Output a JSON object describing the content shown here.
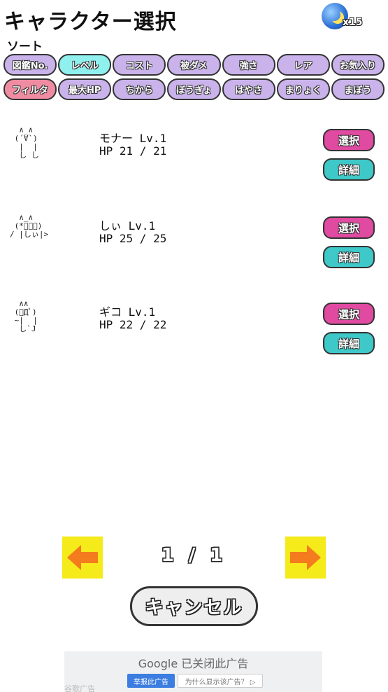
{
  "header": {
    "title": "キャラクター選択",
    "coin_icon": "moon-coin-icon",
    "coin_count": "x15"
  },
  "sort": {
    "label": "ソート",
    "chips": [
      {
        "label": "図鑑No.",
        "active": false
      },
      {
        "label": "レベル",
        "active": true
      },
      {
        "label": "コスト",
        "active": false
      },
      {
        "label": "被ダメ",
        "active": false
      },
      {
        "label": "強さ",
        "active": false
      },
      {
        "label": "レア",
        "active": false
      },
      {
        "label": "お気入り",
        "active": false
      }
    ],
    "filter_chips": [
      {
        "label": "フィルタ",
        "filter": true
      },
      {
        "label": "最大HP"
      },
      {
        "label": "ちから"
      },
      {
        "label": "ぼうぎょ"
      },
      {
        "label": "はやさ"
      },
      {
        "label": "まりょく"
      },
      {
        "label": "まぼう"
      }
    ]
  },
  "characters": [
    {
      "ascii": "  ∧_∧\n (´∀`)\n  |  |\n  し し",
      "name_level": "モナー Lv.1",
      "hp": "HP 21 / 21",
      "select_label": "選択",
      "detail_label": "詳細"
    },
    {
      "ascii": "  ∧_∧\n (*ﾟーﾟ)\n/ |しぃ|>",
      "name_level": "しぃ Lv.1",
      "hp": "HP 25 / 25",
      "select_label": "選択",
      "detail_label": "詳細"
    },
    {
      "ascii": "  ∧∧\n (ﾟДﾟ)\n ~|  |\n  し`J",
      "name_level": "ギコ Lv.1",
      "hp": "HP 22 / 22",
      "select_label": "選択",
      "detail_label": "詳細"
    }
  ],
  "pagination": {
    "indicator": "1 / 1",
    "prev_icon": "arrow-left-icon",
    "next_icon": "arrow-right-icon"
  },
  "cancel_label": "キャンセル",
  "ad": {
    "head": "Google 已关闭此广告",
    "report": "举报此广告",
    "why": "为什么显示该广告？ ▷",
    "foot": "谷歌广告"
  },
  "colors": {
    "chip_default": "#c9b3ea",
    "chip_active": "#8ff0ee",
    "chip_filter": "#f08ca2",
    "select_button": "#e04aa0",
    "detail_button": "#3fc8c8",
    "arrow_bg": "#f5ea1a",
    "arrow_fg": "#f47b1e"
  }
}
